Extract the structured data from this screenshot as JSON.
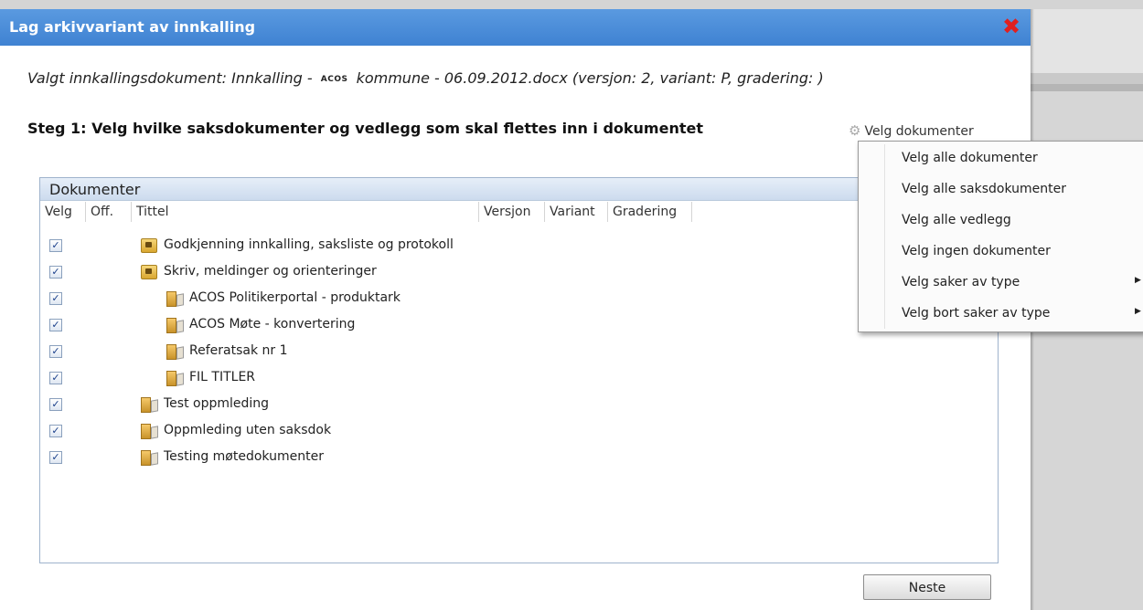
{
  "dialog": {
    "title": "Lag arkivvariant av innkalling",
    "selected_prefix": "Valgt innkallingsdokument: Innkalling -",
    "selected_logo": "ACOS",
    "selected_suffix": "kommune - 06.09.2012.docx (versjon: 2, variant: P, gradering: )",
    "step_title": "Steg 1: Velg hvilke saksdokumenter og vedlegg som skal flettes inn i dokumentet",
    "velg_link": "Velg dokumenter",
    "next_button": "Neste"
  },
  "panel": {
    "title": "Dokumenter",
    "columns": [
      "Velg",
      "Off.",
      "Tittel",
      "Versjon",
      "Variant",
      "Gradering"
    ]
  },
  "rows": [
    {
      "title": "Godkjenning innkalling, saksliste og protokoll",
      "icon": "folder-icon",
      "checked": true,
      "indent": 0
    },
    {
      "title": "Skriv, meldinger og orienteringer",
      "icon": "folder-icon",
      "checked": true,
      "indent": 0
    },
    {
      "title": "ACOS Politikerportal - produktark",
      "icon": "document-icon",
      "checked": true,
      "indent": 1
    },
    {
      "title": "ACOS Møte - konvertering",
      "icon": "document-icon",
      "checked": true,
      "indent": 1
    },
    {
      "title": "Referatsak nr 1",
      "icon": "document-icon",
      "checked": true,
      "indent": 1
    },
    {
      "title": "FIL TITLER",
      "icon": "document-icon",
      "checked": true,
      "indent": 1
    },
    {
      "title": "Test oppmleding",
      "icon": "document-icon",
      "checked": true,
      "indent": 0
    },
    {
      "title": "Oppmleding uten saksdok",
      "icon": "document-icon",
      "checked": true,
      "indent": 0
    },
    {
      "title": "Testing møtedokumenter",
      "icon": "document-icon",
      "checked": true,
      "indent": 0
    }
  ],
  "menu": {
    "items": [
      {
        "label": "Velg alle dokumenter",
        "submenu": false
      },
      {
        "label": "Velg alle saksdokumenter",
        "submenu": false
      },
      {
        "label": "Velg alle vedlegg",
        "submenu": false
      },
      {
        "label": "Velg ingen dokumenter",
        "submenu": false
      },
      {
        "label": "Velg saker av type",
        "submenu": true
      },
      {
        "label": "Velg bort saker av type",
        "submenu": true
      }
    ]
  }
}
